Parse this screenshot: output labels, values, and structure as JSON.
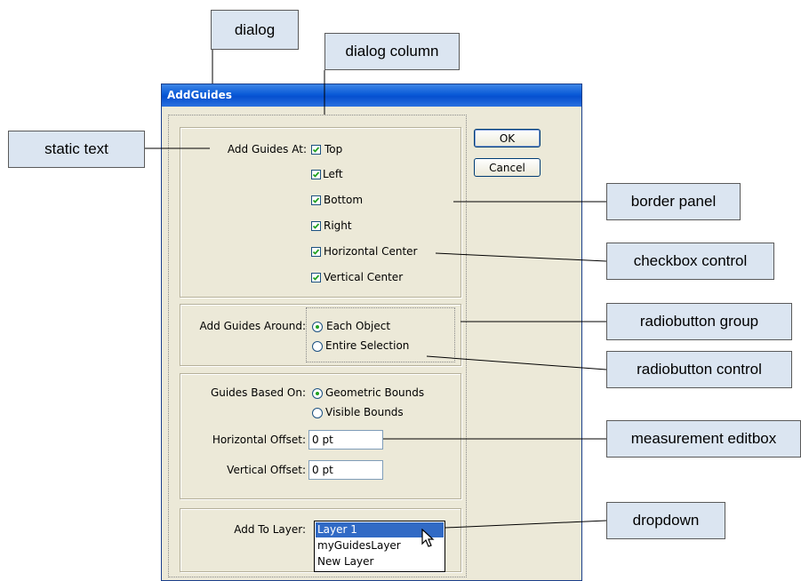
{
  "dialog": {
    "title": "AddGuides",
    "buttons": {
      "ok": "OK",
      "cancel": "Cancel"
    },
    "add_guides_at": {
      "label": "Add Guides At:",
      "options": [
        {
          "label": "Top",
          "checked": true
        },
        {
          "label": "Left",
          "checked": true
        },
        {
          "label": "Bottom",
          "checked": true
        },
        {
          "label": "Right",
          "checked": true
        },
        {
          "label": "Horizontal Center",
          "checked": true
        },
        {
          "label": "Vertical Center",
          "checked": true
        }
      ]
    },
    "add_guides_around": {
      "label": "Add Guides Around:",
      "options": [
        {
          "label": "Each Object",
          "selected": true
        },
        {
          "label": "Entire Selection",
          "selected": false
        }
      ]
    },
    "guides_based_on": {
      "label": "Guides Based On:",
      "options": [
        {
          "label": "Geometric Bounds",
          "selected": true
        },
        {
          "label": "Visible Bounds",
          "selected": false
        }
      ]
    },
    "horizontal_offset": {
      "label": "Horizontal Offset:",
      "value": "0 pt"
    },
    "vertical_offset": {
      "label": "Vertical Offset:",
      "value": "0 pt"
    },
    "add_to_layer": {
      "label": "Add To Layer:",
      "options": [
        "Layer 1",
        "myGuidesLayer",
        "New Layer"
      ],
      "selected": "Layer 1"
    }
  },
  "callouts": {
    "dialog": "dialog",
    "dialog_column": "dialog column",
    "static_text": "static text",
    "border_panel": "border panel",
    "checkbox_control": "checkbox control",
    "radiobutton_group": "radiobutton group",
    "radiobutton_control": "radiobutton control",
    "measurement_editbox": "measurement editbox",
    "dropdown": "dropdown"
  }
}
